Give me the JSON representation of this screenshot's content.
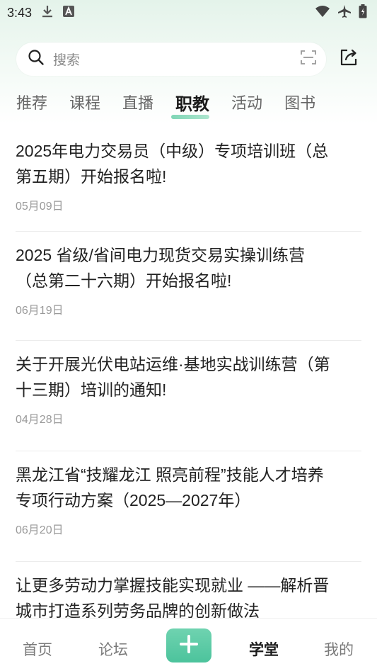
{
  "status_bar": {
    "time": "3:43",
    "icons": [
      "download-icon",
      "a-box-icon",
      "wifi-icon",
      "airplane-icon",
      "battery-icon"
    ]
  },
  "search": {
    "placeholder": "搜索"
  },
  "tabs": [
    {
      "label": "推荐",
      "active": false
    },
    {
      "label": "课程",
      "active": false
    },
    {
      "label": "直播",
      "active": false
    },
    {
      "label": "职教",
      "active": true
    },
    {
      "label": "活动",
      "active": false
    },
    {
      "label": "图书",
      "active": false
    }
  ],
  "articles": [
    {
      "title_line1": "2025年电力交易员（中级）专项培训班（总",
      "title_line2": "第五期）开始报名啦!",
      "date": "05月09日"
    },
    {
      "title_line1": "2025 省级/省间电力现货交易实操训练营",
      "title_line2": "（总第二十六期）开始报名啦!",
      "date": "06月19日"
    },
    {
      "title_line1": "关于开展光伏电站运维·基地实战训练营（第",
      "title_line2": "十三期）培训的通知!",
      "date": "04月28日"
    },
    {
      "title_line1": "黑龙江省“技耀龙江 照亮前程”技能人才培养",
      "title_line2": "专项行动方案（2025—2027年）",
      "date": "06月20日"
    },
    {
      "title_line1": "让更多劳动力掌握技能实现就业 ——解析晋",
      "title_line2": "城市打造系列劳务品牌的创新做法",
      "date": ""
    }
  ],
  "bottom_nav": {
    "home": "首页",
    "forum": "论坛",
    "plus": "+",
    "study": "学堂",
    "mine": "我的"
  },
  "colors": {
    "accent": "#4cc39c",
    "tab_underline": "#7fd6b6"
  }
}
